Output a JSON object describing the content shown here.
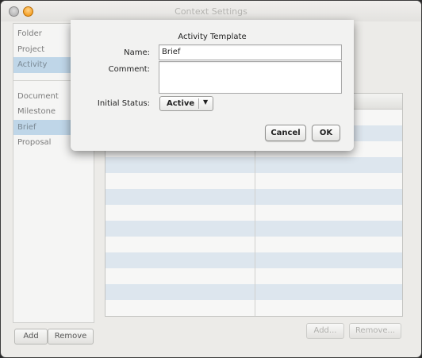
{
  "window": {
    "title": "Context Settings"
  },
  "sidebar": {
    "group1": [
      {
        "label": "Folder"
      },
      {
        "label": "Project"
      },
      {
        "label": "Activity"
      }
    ],
    "group2": [
      {
        "label": "Document"
      },
      {
        "label": "Milestone"
      },
      {
        "label": "Brief"
      },
      {
        "label": "Proposal"
      }
    ],
    "add_label": "Add",
    "remove_label": "Remove"
  },
  "main": {
    "add_label": "Add...",
    "remove_label": "Remove..."
  },
  "dialog": {
    "title": "Activity Template",
    "name_label": "Name:",
    "name_value": "Brief",
    "comment_label": "Comment:",
    "comment_value": "",
    "status_label": "Initial Status:",
    "status_value": "Active",
    "cancel_label": "Cancel",
    "ok_label": "OK"
  }
}
